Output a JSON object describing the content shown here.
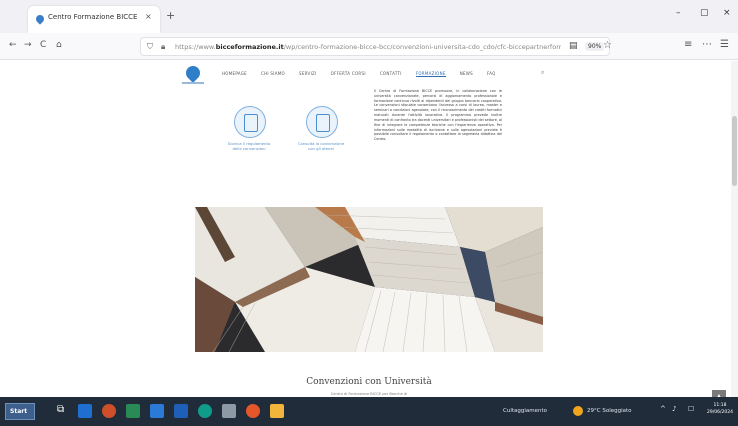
{
  "browser": {
    "tab_title": "Centro Formazione BICCE Sar...",
    "tab_close": "×",
    "tab_new": "+",
    "window_controls": [
      "–",
      "▢",
      "×"
    ],
    "nav": {
      "back": "←",
      "forward": "→",
      "reload": "C",
      "home": "⌂"
    },
    "url_host": "https://www.",
    "url_bold": "bicceformazione.it",
    "url_rest": "/wp/centro-formazione-bicce-bcc/convenzioni-universita-cdo_cdo/cfc-biccepartnerformazione",
    "zoom": "90%",
    "toolbar_icons": [
      "≡",
      "⋯",
      "☰"
    ]
  },
  "site": {
    "menu": [
      "Homepage",
      "Chi siamo",
      "Servizi",
      "Offerta Corsi",
      "Contatti",
      "Formazione",
      "News",
      "FAQ"
    ],
    "active_menu_index": 5,
    "search_icon": "⌕",
    "circle_items": [
      {
        "label": "Scarica il regolamento\ndelle convenzioni"
      },
      {
        "label": "Consulta la convenzione\ncon gli atenei"
      }
    ],
    "text_column": "Il Centro di Formazione BICCE promuove, in collaborazione con le università convenzionate, percorsi di aggiornamento professionale e formazione continua rivolti ai dipendenti del gruppo bancario cooperativo. Le convenzioni stipulate consentono l'accesso a corsi di laurea, master e seminari a condizioni agevolate, con il riconoscimento dei crediti formativi maturati durante l'attività lavorativa. Il programma prevede inoltre momenti di confronto tra docenti universitari e professionisti del settore, al fine di integrare le competenze teoriche con l'esperienza operativa. Per informazioni sulle modalità di iscrizione e sulle agevolazioni previste è possibile consultare il regolamento o contattare la segreteria didattica del Centro.",
    "section_title": "Convenzioni con Università",
    "section_subtitle": "Centro di Formazione BICCE per Banche di"
  },
  "taskbar": {
    "start_label": "Start",
    "search_hint": "⌕",
    "news_text": "Cultaggiamento",
    "weather": "29°C Soleggiato",
    "time": "11:18",
    "date": "29/06/2024",
    "tray_icons": [
      "^",
      "♪",
      "☐"
    ]
  },
  "colors": {
    "accent": "#2f6db3",
    "circle_border": "#7fb2e0",
    "taskbar": "#202c3a"
  }
}
